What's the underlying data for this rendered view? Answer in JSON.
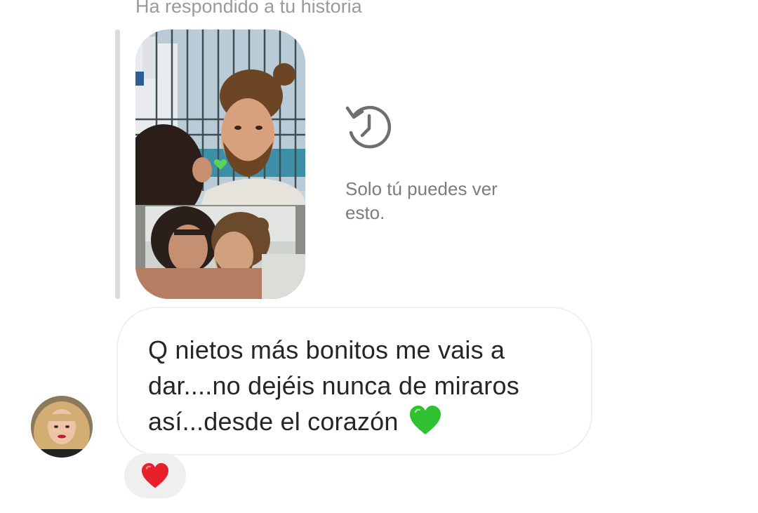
{
  "thread": {
    "context_label": "Ha respondido a tu historia",
    "expired_notice": "Solo tú puedes ver esto.",
    "expired_icon": "history-icon",
    "message": {
      "text": "Q nietos más bonitos me vais a dar....no dejéis nunca de miraros así...desde el corazón",
      "trailing_emoji": "green-heart-icon"
    },
    "reaction": {
      "icon": "red-heart-icon"
    }
  },
  "colors": {
    "bubble_border": "#efefef",
    "reaction_bg": "#efefef",
    "green_heart": "#2fc12f",
    "red_heart": "#e8202c"
  }
}
